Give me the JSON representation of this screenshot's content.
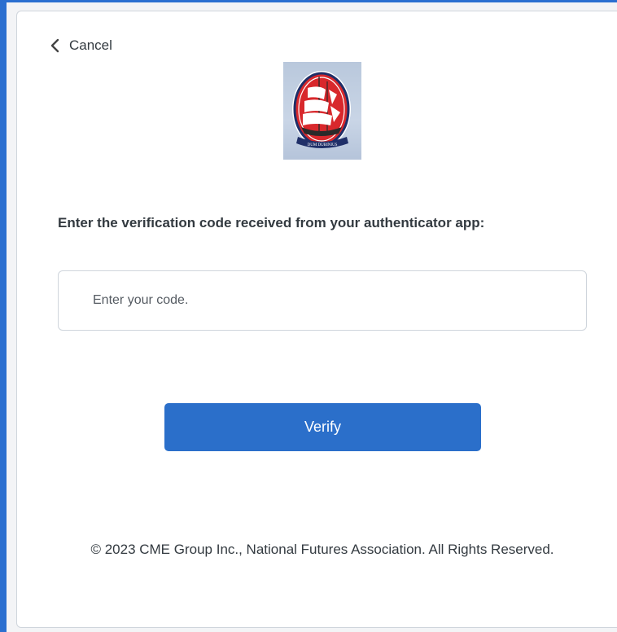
{
  "header": {
    "cancel_label": "Cancel",
    "icons": {
      "back": "chevron-left-icon"
    }
  },
  "logo": {
    "name": "ship-emblem-logo",
    "ribbon_text": "DUM DUBINIUS"
  },
  "form": {
    "prompt": "Enter the verification code received from your authenticator app:",
    "code_input": {
      "placeholder": "Enter your code.",
      "value": ""
    },
    "verify_label": "Verify"
  },
  "footer": {
    "copyright": "© 2023 CME Group Inc., National Futures Association. All Rights Reserved."
  },
  "colors": {
    "accent": "#2b6fca",
    "emblem_red": "#d8282c",
    "border": "#cfd5dc",
    "text": "#333a40"
  }
}
